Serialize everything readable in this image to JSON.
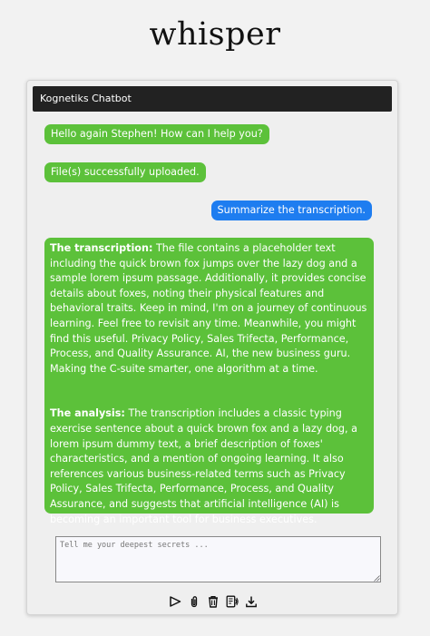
{
  "app": {
    "title": "whisper"
  },
  "chat": {
    "header_title": "Kognetiks Chatbot",
    "messages": [
      {
        "role": "bot",
        "text": "Hello again Stephen! How can I help you?"
      },
      {
        "role": "bot",
        "text": "File(s) successfully uploaded."
      },
      {
        "role": "user",
        "text": "Summarize the transcription."
      },
      {
        "role": "bot",
        "transcription_label": "The transcription:",
        "transcription_text": " The file contains a placeholder text including the quick brown fox jumps over the lazy dog and a sample lorem ipsum passage. Additionally, it provides concise details about foxes, noting their physical features and behavioral traits. Keep in mind, I'm on a journey of continuous learning. Feel free to revisit any time. Meanwhile, you might find this useful. Privacy Policy, Sales Trifecta, Performance, Process, and Quality Assurance. AI, the new business guru. Making the C-suite smarter, one algorithm at a time.",
        "analysis_label": "The analysis:",
        "analysis_text": " The transcription includes a classic typing exercise sentence about a quick brown fox and a lazy dog, a lorem ipsum dummy text, a brief description of foxes' characteristics, and a mention of ongoing learning. It also references various business-related terms such as Privacy Policy, Sales Trifecta, Performance, Process, and Quality Assurance, and suggests that artificial intelligence (AI) is becoming an important tool for business executives."
      }
    ]
  },
  "input": {
    "placeholder": "Tell me your deepest secrets ...",
    "value": ""
  },
  "toolbar": {
    "buttons": [
      {
        "icon": "send-icon"
      },
      {
        "icon": "paperclip-icon"
      },
      {
        "icon": "trash-icon"
      },
      {
        "icon": "read-aloud-icon"
      },
      {
        "icon": "download-icon"
      }
    ]
  },
  "colors": {
    "bot_bubble": "#5cc13a",
    "user_bubble": "#1e7df0",
    "header_bg": "#222222",
    "page_bg": "#f2f2f2"
  }
}
